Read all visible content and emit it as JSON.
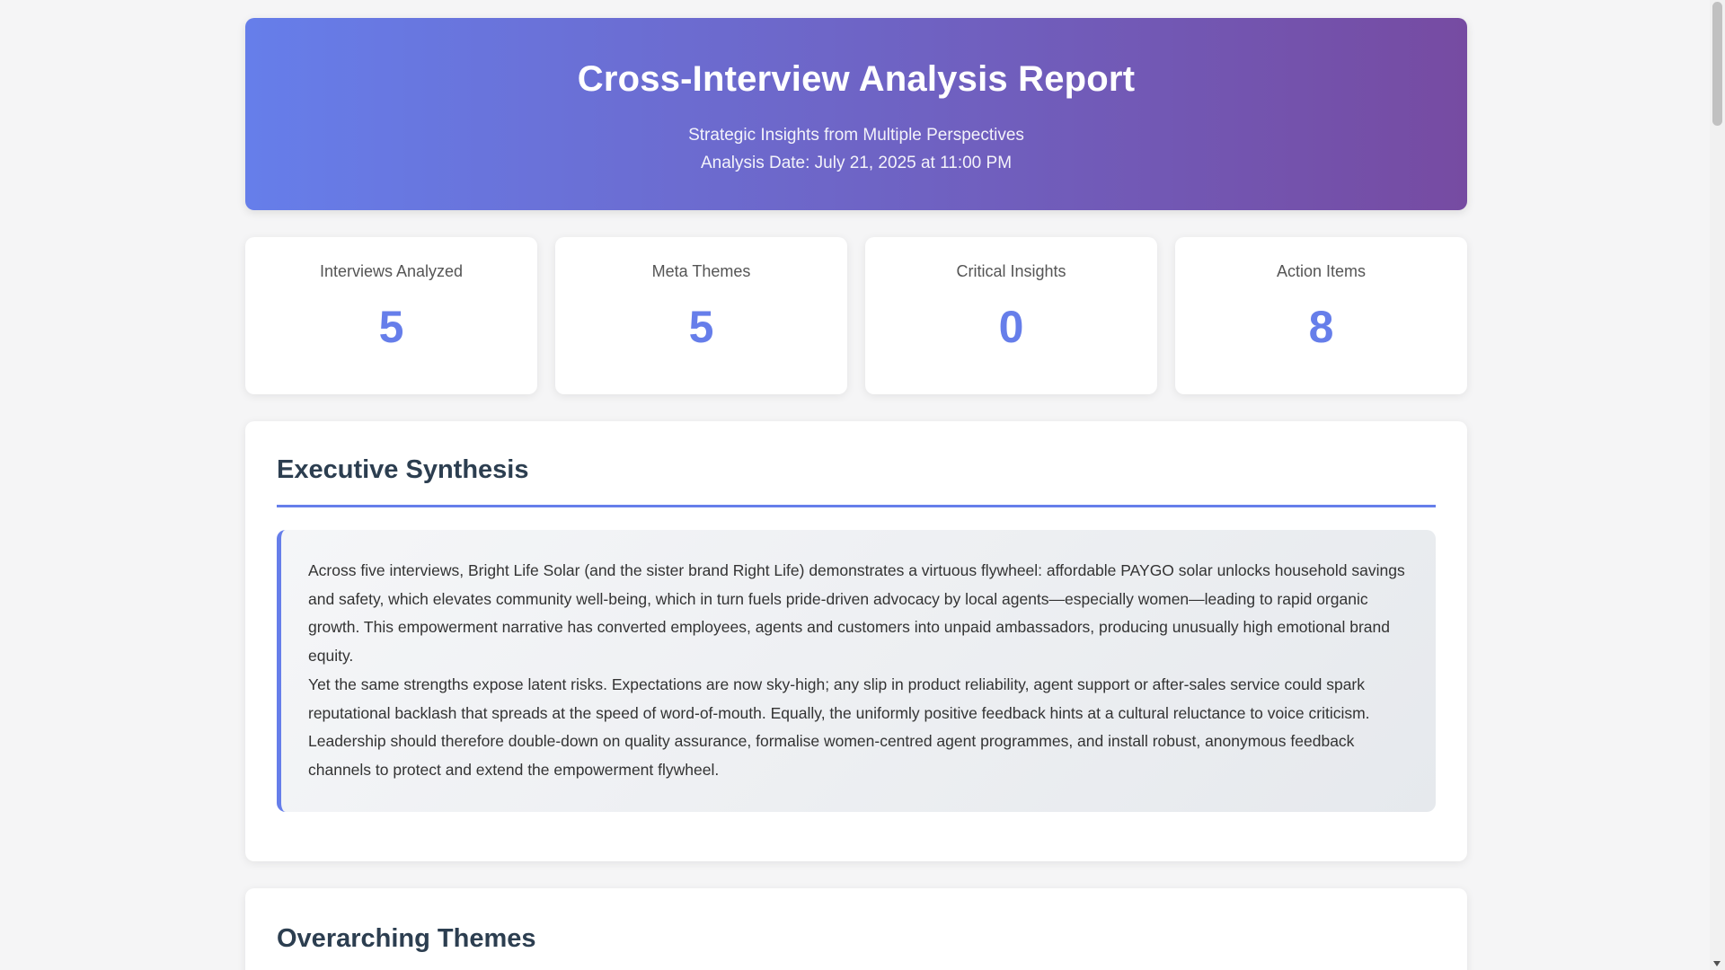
{
  "header": {
    "title": "Cross-Interview Analysis Report",
    "subtitle": "Strategic Insights from Multiple Perspectives",
    "date": "Analysis Date: July 21, 2025 at 11:00 PM"
  },
  "stats": [
    {
      "label": "Interviews Analyzed",
      "value": "5"
    },
    {
      "label": "Meta Themes",
      "value": "5"
    },
    {
      "label": "Critical Insights",
      "value": "0"
    },
    {
      "label": "Action Items",
      "value": "8"
    }
  ],
  "executive": {
    "title": "Executive Synthesis",
    "paragraph1": "Across five interviews, Bright Life Solar (and the sister brand Right Life) demonstrates a virtuous flywheel: affordable PAYGO solar unlocks household savings and safety, which elevates community well-being, which in turn fuels pride-driven advocacy by local agents—especially women—leading to rapid organic growth. This empowerment narrative has converted employees, agents and customers into unpaid ambassadors, producing unusually high emotional brand equity.",
    "paragraph2": "Yet the same strengths expose latent risks. Expectations are now sky-high; any slip in product reliability, agent support or after-sales service could spark reputational backlash that spreads at the speed of word-of-mouth. Equally, the uniformly positive feedback hints at a cultural reluctance to voice criticism. Leadership should therefore double-down on quality assurance, formalise women-centred agent programmes, and install robust, anonymous feedback channels to protect and extend the empowerment flywheel."
  },
  "themes": {
    "title": "Overarching Themes"
  }
}
